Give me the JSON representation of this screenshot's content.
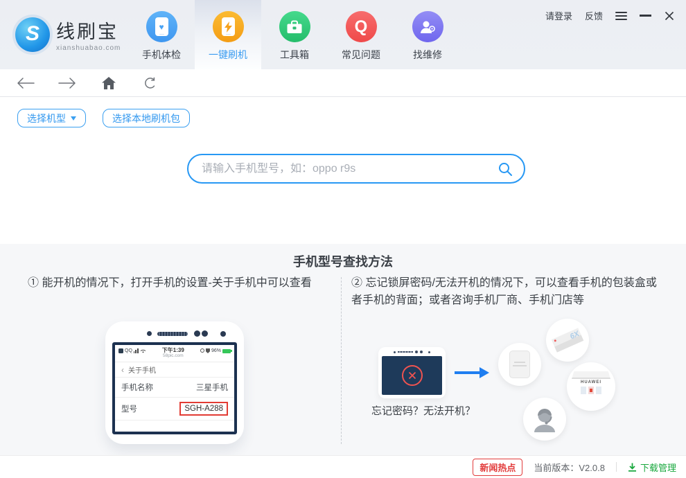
{
  "titlebar": {
    "login": "请登录",
    "feedback": "反馈"
  },
  "logo": {
    "letter": "S",
    "brand": "线刷宝",
    "domain": "xianshuabao.com"
  },
  "nav": {
    "items": [
      {
        "label": "手机体检",
        "icon": "phone-health-icon",
        "color": "#47a2f4",
        "active": false
      },
      {
        "label": "一键刷机",
        "icon": "phone-flash-icon",
        "color": "#f7a81f",
        "active": true
      },
      {
        "label": "工具箱",
        "icon": "toolbox-icon",
        "color": "#2fc97a",
        "active": false
      },
      {
        "label": "常见问题",
        "icon": "faq-icon",
        "color": "#f35b5b",
        "active": false
      },
      {
        "label": "找维修",
        "icon": "repair-icon",
        "color": "#7d74f0",
        "active": false
      }
    ]
  },
  "actions": {
    "select_model": "选择机型",
    "select_local_pkg": "选择本地刷机包"
  },
  "search": {
    "placeholder": "请输入手机型号，如：oppo r9s"
  },
  "guide": {
    "title": "手机型号查找方法",
    "step1": "① 能开机的情况下，打开手机的设置-关于手机中可以查看",
    "step2": "② 忘记锁屏密码/无法开机的情况下，可以查看手机的包装盒或者手机的背面；或者咨询手机厂商、手机门店等"
  },
  "phone_demo": {
    "qq": "QQ",
    "time": "下午1:39",
    "site": "58pic.com",
    "battery": "96%",
    "back_arrow": "‹",
    "back_title": "关于手机",
    "name_label": "手机名称",
    "name_value": "三星手机",
    "model_label": "型号",
    "model_value": "SGH-A288"
  },
  "illustration": {
    "caption": "忘记密码？无法开机？",
    "store_sign": "HUAWEI",
    "box_label": "6X"
  },
  "footer": {
    "news": "新闻热点",
    "version": "当前版本：V2.0.8",
    "download": "下载管理"
  },
  "colors": {
    "accent_blue": "#2798f4",
    "header_bg": "#edf0f4",
    "section_bg": "#f6f7f9",
    "alert_red": "#e23b3b",
    "success_green": "#19a83e",
    "screen_navy": "#1e3a5a"
  }
}
